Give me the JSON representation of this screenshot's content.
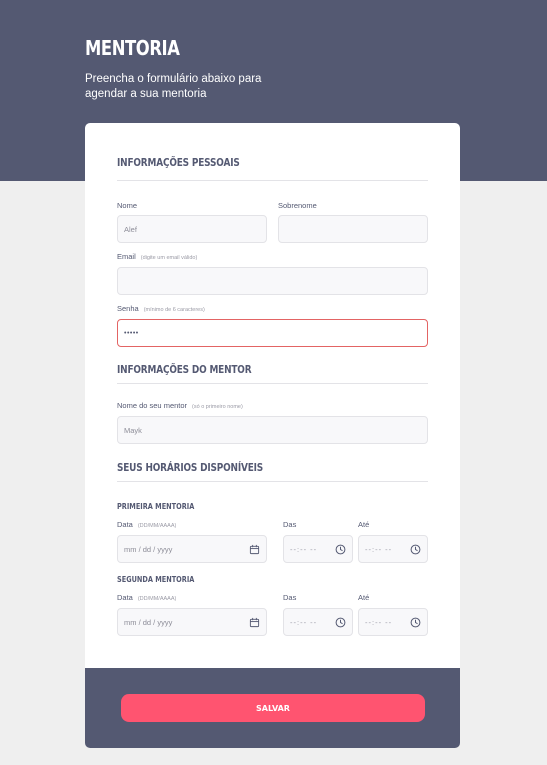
{
  "header": {
    "title": "MENTORIA",
    "subtitle": "Preencha o formulário abaixo para agendar a sua mentoria"
  },
  "personal": {
    "title": "INFORMAÇÕES PESSOAIS",
    "first_name_label": "Nome",
    "first_name_value": "Alef",
    "last_name_label": "Sobrenome",
    "last_name_value": "",
    "email_label": "Email",
    "email_hint": "(digite um email válido)",
    "email_value": "",
    "password_label": "Senha",
    "password_hint": "(mínimo de 6 caracteres)",
    "password_value": "•••••"
  },
  "mentor": {
    "title": "INFORMAÇÕES DO MENTOR",
    "name_label": "Nome do seu mentor",
    "name_hint": "(só o primeiro nome)",
    "name_value": "Mayk"
  },
  "schedule": {
    "title": "SEUS HORÁRIOS DISPONÍVEIS",
    "first": {
      "title": "PRIMEIRA MENTORIA",
      "date_label": "Data",
      "date_hint": "(DD/MM/AAAA)",
      "date_placeholder": "mm / dd / yyyy",
      "from_label": "Das",
      "to_label": "Até",
      "time_placeholder": "--:-- --"
    },
    "second": {
      "title": "SEGUNDA MENTORIA",
      "date_label": "Data",
      "date_hint": "(DD/MM/AAAA)",
      "date_placeholder": "mm / dd / yyyy",
      "from_label": "Das",
      "to_label": "Até",
      "time_placeholder": "--:-- --"
    }
  },
  "footer": {
    "save_label": "SALVAR"
  },
  "colors": {
    "header_bg": "#545972",
    "accent": "#FF5470",
    "error_border": "#E36464",
    "page_bg": "#EFEFEF"
  }
}
